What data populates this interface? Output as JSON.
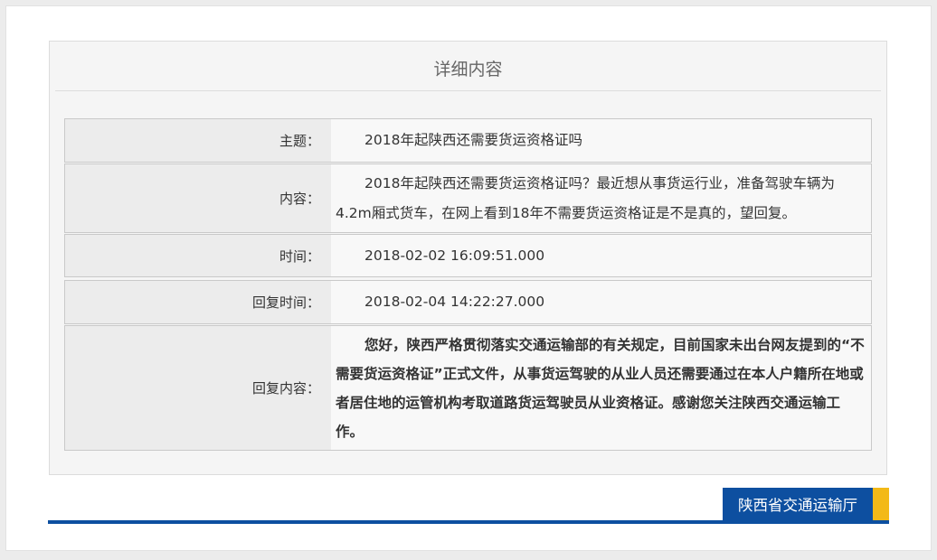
{
  "panel": {
    "title": "详细内容"
  },
  "fields": [
    {
      "label": "主题：",
      "value": "2018年起陕西还需要货运资格证吗"
    },
    {
      "label": "内容：",
      "value": "2018年起陕西还需要货运资格证吗？最近想从事货运行业，准备驾驶车辆为4.2m厢式货车，在网上看到18年不需要货运资格证是不是真的，望回复。"
    },
    {
      "label": "时间：",
      "value": "2018-02-02 16:09:51.000"
    },
    {
      "label": "回复时间：",
      "value": "2018-02-04 14:22:27.000"
    },
    {
      "label": "回复内容：",
      "value": "您好，陕西严格贯彻落实交通运输部的有关规定，目前国家未出台网友提到的“不需要货运资格证”正式文件，从事货运驾驶的从业人员还需要通过在本人户籍所在地或者居住地的运管机构考取道路货运驾驶员从业资格证。感谢您关注陕西交通运输工作。"
    }
  ],
  "footer": {
    "brand": "陕西省交通运输厅"
  },
  "colors": {
    "brand_blue": "#0d4fa0",
    "accent_yellow": "#f3b917"
  }
}
